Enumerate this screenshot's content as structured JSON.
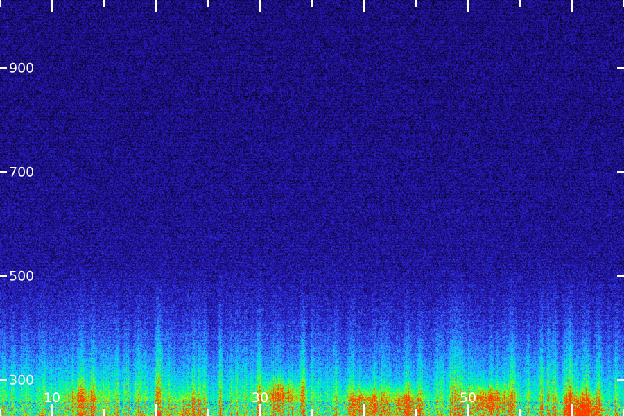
{
  "chart_data": {
    "type": "heatmap",
    "title": "",
    "xlabel": "",
    "ylabel": "",
    "colormap": [
      "#000000",
      "#1a0a6e",
      "#2a1fd6",
      "#3a7cff",
      "#00e0ff",
      "#00ff7a",
      "#b8ff00",
      "#ff3a00"
    ],
    "xlim": [
      5,
      65
    ],
    "ylim": [
      230,
      1030
    ],
    "x_ticks": [
      10,
      20,
      30,
      40,
      50,
      60
    ],
    "x_tick_labels": [
      "10",
      "",
      "30",
      "",
      "50",
      ""
    ],
    "y_ticks": [
      300,
      500,
      700,
      900
    ],
    "y_tick_labels": [
      "300",
      "500",
      "700",
      "900"
    ],
    "intensity_profile": {
      "description_of_bands": "high energy near the bottom of the frequency axis, decaying with frequency",
      "frequency": [
        230,
        260,
        300,
        340,
        400,
        450,
        500,
        600,
        800,
        1030
      ],
      "mean_intensity": [
        0.72,
        0.62,
        0.5,
        0.4,
        0.3,
        0.26,
        0.24,
        0.22,
        0.2,
        0.19
      ]
    },
    "hotspots": [
      {
        "x": 32,
        "y": 270,
        "intensity": 0.75
      },
      {
        "x": 40,
        "y": 252,
        "intensity": 0.8
      },
      {
        "x": 44,
        "y": 250,
        "intensity": 0.78
      },
      {
        "x": 52,
        "y": 258,
        "intensity": 0.82
      },
      {
        "x": 61,
        "y": 240,
        "intensity": 0.95
      },
      {
        "x": 23,
        "y": 245,
        "intensity": 0.6
      },
      {
        "x": 13,
        "y": 260,
        "intensity": 0.62
      }
    ]
  }
}
